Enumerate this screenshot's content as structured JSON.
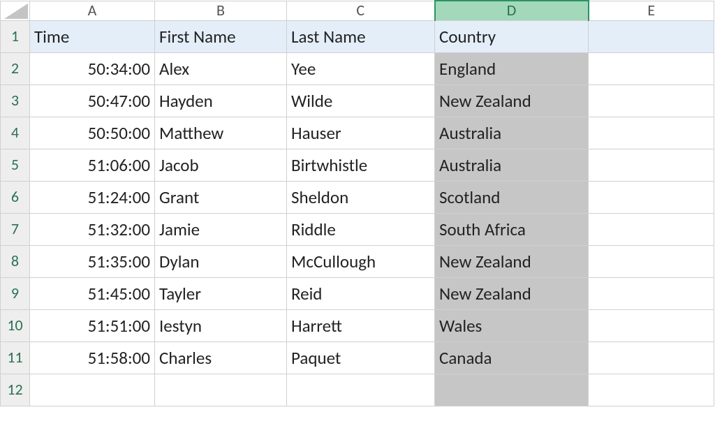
{
  "columns": [
    "",
    "A",
    "B",
    "C",
    "D",
    "E"
  ],
  "selected_column_index": 4,
  "header": {
    "A": "Time",
    "B": "First Name",
    "C": "Last Name",
    "D": "Country"
  },
  "rows": [
    {
      "A": "50:34:00",
      "B": "Alex",
      "C": "Yee",
      "D": "England"
    },
    {
      "A": "50:47:00",
      "B": "Hayden",
      "C": "Wilde",
      "D": "New Zealand"
    },
    {
      "A": "50:50:00",
      "B": "Matthew",
      "C": "Hauser",
      "D": "Australia"
    },
    {
      "A": "51:06:00",
      "B": "Jacob",
      "C": "Birtwhistle",
      "D": "Australia"
    },
    {
      "A": "51:24:00",
      "B": "Grant",
      "C": "Sheldon",
      "D": "Scotland"
    },
    {
      "A": "51:32:00",
      "B": "Jamie",
      "C": "Riddle",
      "D": "South Africa"
    },
    {
      "A": "51:35:00",
      "B": "Dylan",
      "C": "McCullough",
      "D": "New Zealand"
    },
    {
      "A": "51:45:00",
      "B": "Tayler",
      "C": "Reid",
      "D": "New Zealand"
    },
    {
      "A": "51:51:00",
      "B": "Iestyn",
      "C": "Harrett",
      "D": "Wales"
    },
    {
      "A": "51:58:00",
      "B": "Charles",
      "C": "Paquet",
      "D": "Canada"
    }
  ],
  "blank_row_count_after": 1,
  "row_numbers": [
    "1",
    "2",
    "3",
    "4",
    "5",
    "6",
    "7",
    "8",
    "9",
    "10",
    "11",
    "12"
  ]
}
